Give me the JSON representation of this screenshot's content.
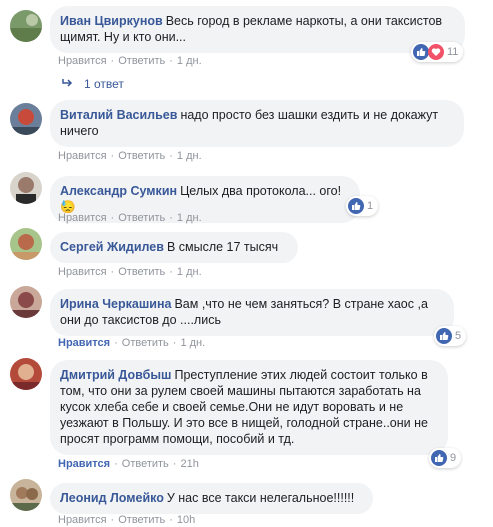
{
  "colors": {
    "link": "#385898",
    "like": "#4267b2",
    "bubble": "#f2f3f5",
    "meta": "#90949c"
  },
  "comments": [
    {
      "author": "Иван Цвиркунов",
      "text": "Весь город в рекламе наркоты, а они таксистов щимят. Ну и кто они...",
      "like": "Нравится",
      "reply": "Ответить",
      "time": "1 дн.",
      "reactions": [
        "like-icon",
        "love-icon"
      ],
      "reaction_count": "11",
      "replies_label": "1 ответ"
    },
    {
      "author": "Виталий Васильев",
      "text": "надо просто без шашки ездить и не докажут ничего",
      "like": "Нравится",
      "reply": "Ответить",
      "time": "1 дн."
    },
    {
      "author": "Александр Сумкин",
      "text": "Целых два протокола... ого!😓",
      "like": "Нравится",
      "reply": "Ответить",
      "time": "1 дн.",
      "reactions": [
        "like-icon"
      ],
      "reaction_count": "1"
    },
    {
      "author": "Сергей Жидилев",
      "text": "В смысле 17 тысяч",
      "like": "Нравится",
      "reply": "Ответить",
      "time": "1 дн."
    },
    {
      "author": "Ирина Черкашина",
      "text": "Вам ,что не чем заняться? В стране хаос ,а они до таксистов до ....лись",
      "like": "Нравится",
      "reply": "Ответить",
      "time": "1 дн.",
      "reactions": [
        "like-icon"
      ],
      "reaction_count": "5"
    },
    {
      "author": "Дмитрий Довбыш",
      "text": "Преступление этих людей состоит только в том, что они за рулем своей машины пытаются заработать на кусок хлеба себе и своей семье.Они не идут воровать и не уезжают в Польшу. И это все в нищей, голодной стране..они не просят программ помощи, пособий и тд.",
      "like": "Нравится",
      "reply": "Ответить",
      "time": "21h",
      "reactions": [
        "like-icon"
      ],
      "reaction_count": "9"
    },
    {
      "author": "Леонид Ломейко",
      "text": "У нас все такси нелегальное!!!!!!",
      "like": "Нравится",
      "reply": "Ответить",
      "time": "10h"
    }
  ]
}
